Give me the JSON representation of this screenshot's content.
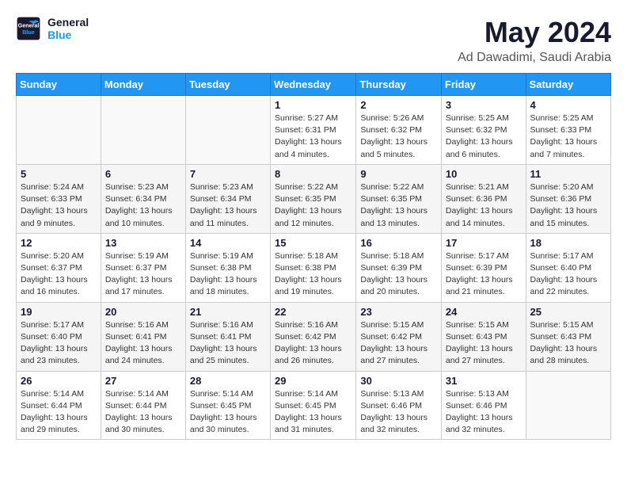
{
  "header": {
    "logo_line1": "General",
    "logo_line2": "Blue",
    "month": "May 2024",
    "location": "Ad Dawadimi, Saudi Arabia"
  },
  "weekdays": [
    "Sunday",
    "Monday",
    "Tuesday",
    "Wednesday",
    "Thursday",
    "Friday",
    "Saturday"
  ],
  "weeks": [
    [
      {
        "day": "",
        "info": ""
      },
      {
        "day": "",
        "info": ""
      },
      {
        "day": "",
        "info": ""
      },
      {
        "day": "1",
        "info": "Sunrise: 5:27 AM\nSunset: 6:31 PM\nDaylight: 13 hours and 4 minutes."
      },
      {
        "day": "2",
        "info": "Sunrise: 5:26 AM\nSunset: 6:32 PM\nDaylight: 13 hours and 5 minutes."
      },
      {
        "day": "3",
        "info": "Sunrise: 5:25 AM\nSunset: 6:32 PM\nDaylight: 13 hours and 6 minutes."
      },
      {
        "day": "4",
        "info": "Sunrise: 5:25 AM\nSunset: 6:33 PM\nDaylight: 13 hours and 7 minutes."
      }
    ],
    [
      {
        "day": "5",
        "info": "Sunrise: 5:24 AM\nSunset: 6:33 PM\nDaylight: 13 hours and 9 minutes."
      },
      {
        "day": "6",
        "info": "Sunrise: 5:23 AM\nSunset: 6:34 PM\nDaylight: 13 hours and 10 minutes."
      },
      {
        "day": "7",
        "info": "Sunrise: 5:23 AM\nSunset: 6:34 PM\nDaylight: 13 hours and 11 minutes."
      },
      {
        "day": "8",
        "info": "Sunrise: 5:22 AM\nSunset: 6:35 PM\nDaylight: 13 hours and 12 minutes."
      },
      {
        "day": "9",
        "info": "Sunrise: 5:22 AM\nSunset: 6:35 PM\nDaylight: 13 hours and 13 minutes."
      },
      {
        "day": "10",
        "info": "Sunrise: 5:21 AM\nSunset: 6:36 PM\nDaylight: 13 hours and 14 minutes."
      },
      {
        "day": "11",
        "info": "Sunrise: 5:20 AM\nSunset: 6:36 PM\nDaylight: 13 hours and 15 minutes."
      }
    ],
    [
      {
        "day": "12",
        "info": "Sunrise: 5:20 AM\nSunset: 6:37 PM\nDaylight: 13 hours and 16 minutes."
      },
      {
        "day": "13",
        "info": "Sunrise: 5:19 AM\nSunset: 6:37 PM\nDaylight: 13 hours and 17 minutes."
      },
      {
        "day": "14",
        "info": "Sunrise: 5:19 AM\nSunset: 6:38 PM\nDaylight: 13 hours and 18 minutes."
      },
      {
        "day": "15",
        "info": "Sunrise: 5:18 AM\nSunset: 6:38 PM\nDaylight: 13 hours and 19 minutes."
      },
      {
        "day": "16",
        "info": "Sunrise: 5:18 AM\nSunset: 6:39 PM\nDaylight: 13 hours and 20 minutes."
      },
      {
        "day": "17",
        "info": "Sunrise: 5:17 AM\nSunset: 6:39 PM\nDaylight: 13 hours and 21 minutes."
      },
      {
        "day": "18",
        "info": "Sunrise: 5:17 AM\nSunset: 6:40 PM\nDaylight: 13 hours and 22 minutes."
      }
    ],
    [
      {
        "day": "19",
        "info": "Sunrise: 5:17 AM\nSunset: 6:40 PM\nDaylight: 13 hours and 23 minutes."
      },
      {
        "day": "20",
        "info": "Sunrise: 5:16 AM\nSunset: 6:41 PM\nDaylight: 13 hours and 24 minutes."
      },
      {
        "day": "21",
        "info": "Sunrise: 5:16 AM\nSunset: 6:41 PM\nDaylight: 13 hours and 25 minutes."
      },
      {
        "day": "22",
        "info": "Sunrise: 5:16 AM\nSunset: 6:42 PM\nDaylight: 13 hours and 26 minutes."
      },
      {
        "day": "23",
        "info": "Sunrise: 5:15 AM\nSunset: 6:42 PM\nDaylight: 13 hours and 27 minutes."
      },
      {
        "day": "24",
        "info": "Sunrise: 5:15 AM\nSunset: 6:43 PM\nDaylight: 13 hours and 27 minutes."
      },
      {
        "day": "25",
        "info": "Sunrise: 5:15 AM\nSunset: 6:43 PM\nDaylight: 13 hours and 28 minutes."
      }
    ],
    [
      {
        "day": "26",
        "info": "Sunrise: 5:14 AM\nSunset: 6:44 PM\nDaylight: 13 hours and 29 minutes."
      },
      {
        "day": "27",
        "info": "Sunrise: 5:14 AM\nSunset: 6:44 PM\nDaylight: 13 hours and 30 minutes."
      },
      {
        "day": "28",
        "info": "Sunrise: 5:14 AM\nSunset: 6:45 PM\nDaylight: 13 hours and 30 minutes."
      },
      {
        "day": "29",
        "info": "Sunrise: 5:14 AM\nSunset: 6:45 PM\nDaylight: 13 hours and 31 minutes."
      },
      {
        "day": "30",
        "info": "Sunrise: 5:13 AM\nSunset: 6:46 PM\nDaylight: 13 hours and 32 minutes."
      },
      {
        "day": "31",
        "info": "Sunrise: 5:13 AM\nSunset: 6:46 PM\nDaylight: 13 hours and 32 minutes."
      },
      {
        "day": "",
        "info": ""
      }
    ]
  ]
}
